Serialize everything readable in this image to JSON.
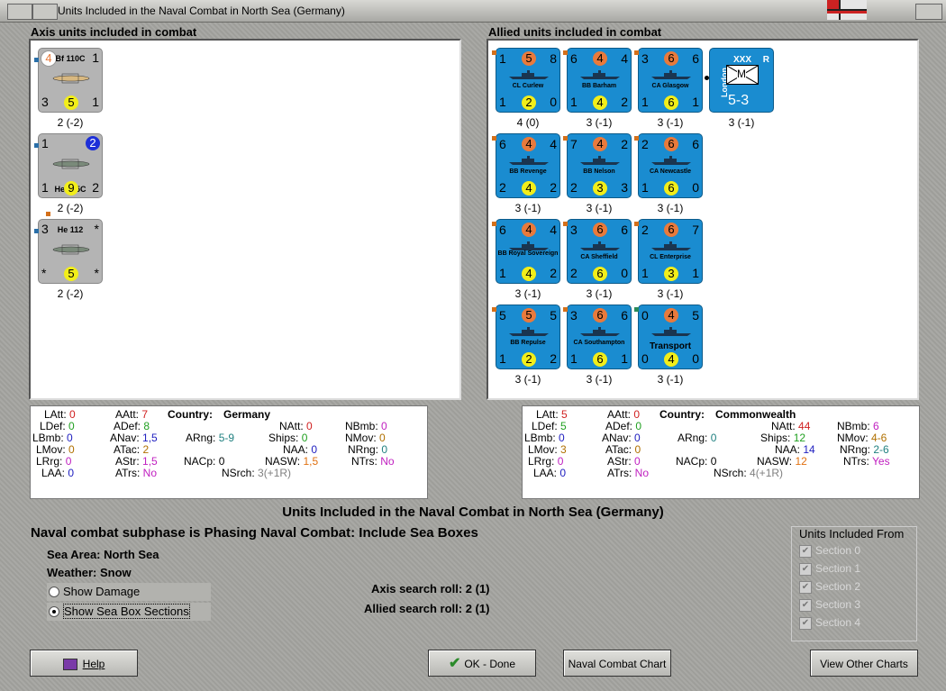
{
  "window": {
    "title": "Units Included in the Naval Combat in North Sea (Germany)"
  },
  "axis_panel": {
    "heading": "Axis units included in combat",
    "units": [
      {
        "name": "Bf 110C",
        "tl": "4",
        "tl_color": "#e87a3c",
        "tr": "1",
        "bl": "3",
        "bc": "5",
        "br": "1",
        "label": "2 (-2)"
      },
      {
        "name": "He 115C",
        "tl": "1",
        "tr": "2",
        "bl": "1",
        "bc": "9",
        "br": "2",
        "label": "2 (-2)"
      },
      {
        "name": "He 112",
        "tl": "3",
        "tr": "*",
        "bl": "*",
        "bc": "5",
        "br": "*",
        "label": "2 (-2)"
      }
    ]
  },
  "allied_panel": {
    "heading": "Allied units included in combat",
    "units": [
      {
        "name": "CL Curlew",
        "tl": "1",
        "tc": "5",
        "tr": "8",
        "bl": "1",
        "bc": "2",
        "br": "0",
        "label": "4 (0)"
      },
      {
        "name": "BB Barham",
        "tl": "6",
        "tc": "4",
        "tr": "4",
        "bl": "1",
        "bc": "4",
        "br": "2",
        "label": "3 (-1)"
      },
      {
        "name": "CA Glasgow",
        "tl": "3",
        "tc": "6",
        "tr": "6",
        "bl": "1",
        "bc": "6",
        "br": "1",
        "label": "3 (-1)"
      },
      {
        "name": "BB Revenge",
        "tl": "6",
        "tc": "4",
        "tr": "4",
        "bl": "2",
        "bc": "4",
        "br": "2",
        "label": "3 (-1)"
      },
      {
        "name": "BB Nelson",
        "tl": "7",
        "tc": "4",
        "tr": "2",
        "bl": "2",
        "bc": "3",
        "br": "3",
        "label": "3 (-1)"
      },
      {
        "name": "CA Newcastle",
        "tl": "2",
        "tc": "6",
        "tr": "6",
        "bl": "1",
        "bc": "6",
        "br": "0",
        "label": "3 (-1)"
      },
      {
        "name": "BB Royal Sovereign",
        "tl": "6",
        "tc": "4",
        "tr": "4",
        "bl": "1",
        "bc": "4",
        "br": "2",
        "label": "3 (-1)"
      },
      {
        "name": "CA Sheffield",
        "tl": "3",
        "tc": "6",
        "tr": "6",
        "bl": "2",
        "bc": "6",
        "br": "0",
        "label": "3 (-1)"
      },
      {
        "name": "CL Enterprise",
        "tl": "2",
        "tc": "6",
        "tr": "7",
        "bl": "1",
        "bc": "3",
        "br": "1",
        "label": "3 (-1)"
      },
      {
        "name": "BB Repulse",
        "tl": "5",
        "tc": "5",
        "tr": "5",
        "bl": "1",
        "bc": "2",
        "br": "2",
        "label": "3 (-1)"
      },
      {
        "name": "CA Southampton",
        "tl": "3",
        "tc": "6",
        "tr": "6",
        "bl": "1",
        "bc": "6",
        "br": "1",
        "label": "3 (-1)"
      },
      {
        "name": "Transport",
        "tl": "0",
        "tc": "4",
        "tr": "5",
        "bl": "0",
        "bc": "4",
        "br": "0",
        "label": "3 (-1)"
      }
    ],
    "army": {
      "side": "London",
      "size": "XXX",
      "type": "M",
      "reserve": "R",
      "strength": "5-3",
      "label": "3 (-1)"
    }
  },
  "axis_stats": {
    "country_label": "Country:",
    "country": "Germany",
    "rows": {
      "LAtt": "0",
      "LDef": "0",
      "LBmb": "0",
      "LMov": "0",
      "LRrg": "0",
      "LAA": "0",
      "AAtt": "7",
      "ADef": "8",
      "ANav": "1,5",
      "ATac": "2",
      "AStr": "1,5",
      "ATrs": "No",
      "ARng": "5-9",
      "NACp": "0",
      "NSrch": "3(+1R)",
      "NAtt": "0",
      "Ships": "0",
      "NAA": "0",
      "NASW": "1,5",
      "NBmb": "0",
      "NMov": "0",
      "NRng": "0",
      "NTrs": "No"
    }
  },
  "allied_stats": {
    "country_label": "Country:",
    "country": "Commonwealth",
    "rows": {
      "LAtt": "5",
      "LDef": "5",
      "LBmb": "0",
      "LMov": "3",
      "LRrg": "0",
      "LAA": "0",
      "AAtt": "0",
      "ADef": "0",
      "ANav": "0",
      "ATac": "0",
      "AStr": "0",
      "ATrs": "No",
      "ARng": "0",
      "NACp": "0",
      "NSrch": "4(+1R)",
      "NAtt": "44",
      "Ships": "12",
      "NAA": "14",
      "NASW": "12",
      "NBmb": "6",
      "NMov": "4-6",
      "NRng": "2-6",
      "NTrs": "Yes"
    }
  },
  "main": {
    "title": "Units Included in the Naval Combat in North Sea (Germany)",
    "subphase": "Naval combat subphase is Phasing Naval Combat: Include Sea Boxes",
    "sea_area": "Sea Area:  North Sea",
    "weather": "Weather:  Snow",
    "axis_roll": "Axis search roll: 2 (1)",
    "allied_roll": "Allied search roll: 2 (1)",
    "show_damage": "Show Damage",
    "show_sea_box": "Show Sea Box Sections"
  },
  "units_from": {
    "heading": "Units Included From",
    "sections": [
      "Section 0",
      "Section 1",
      "Section 2",
      "Section 3",
      "Section 4"
    ]
  },
  "buttons": {
    "help": "Help",
    "ok": "OK - Done",
    "chart": "Naval Combat Chart",
    "other": "View Other Charts"
  },
  "colors": {
    "naval_counter": "#1a8cd0",
    "air_counter": "#b4b4b4",
    "attack_circle": "#e87a3c",
    "defense_circle": "#f2ee1a"
  }
}
